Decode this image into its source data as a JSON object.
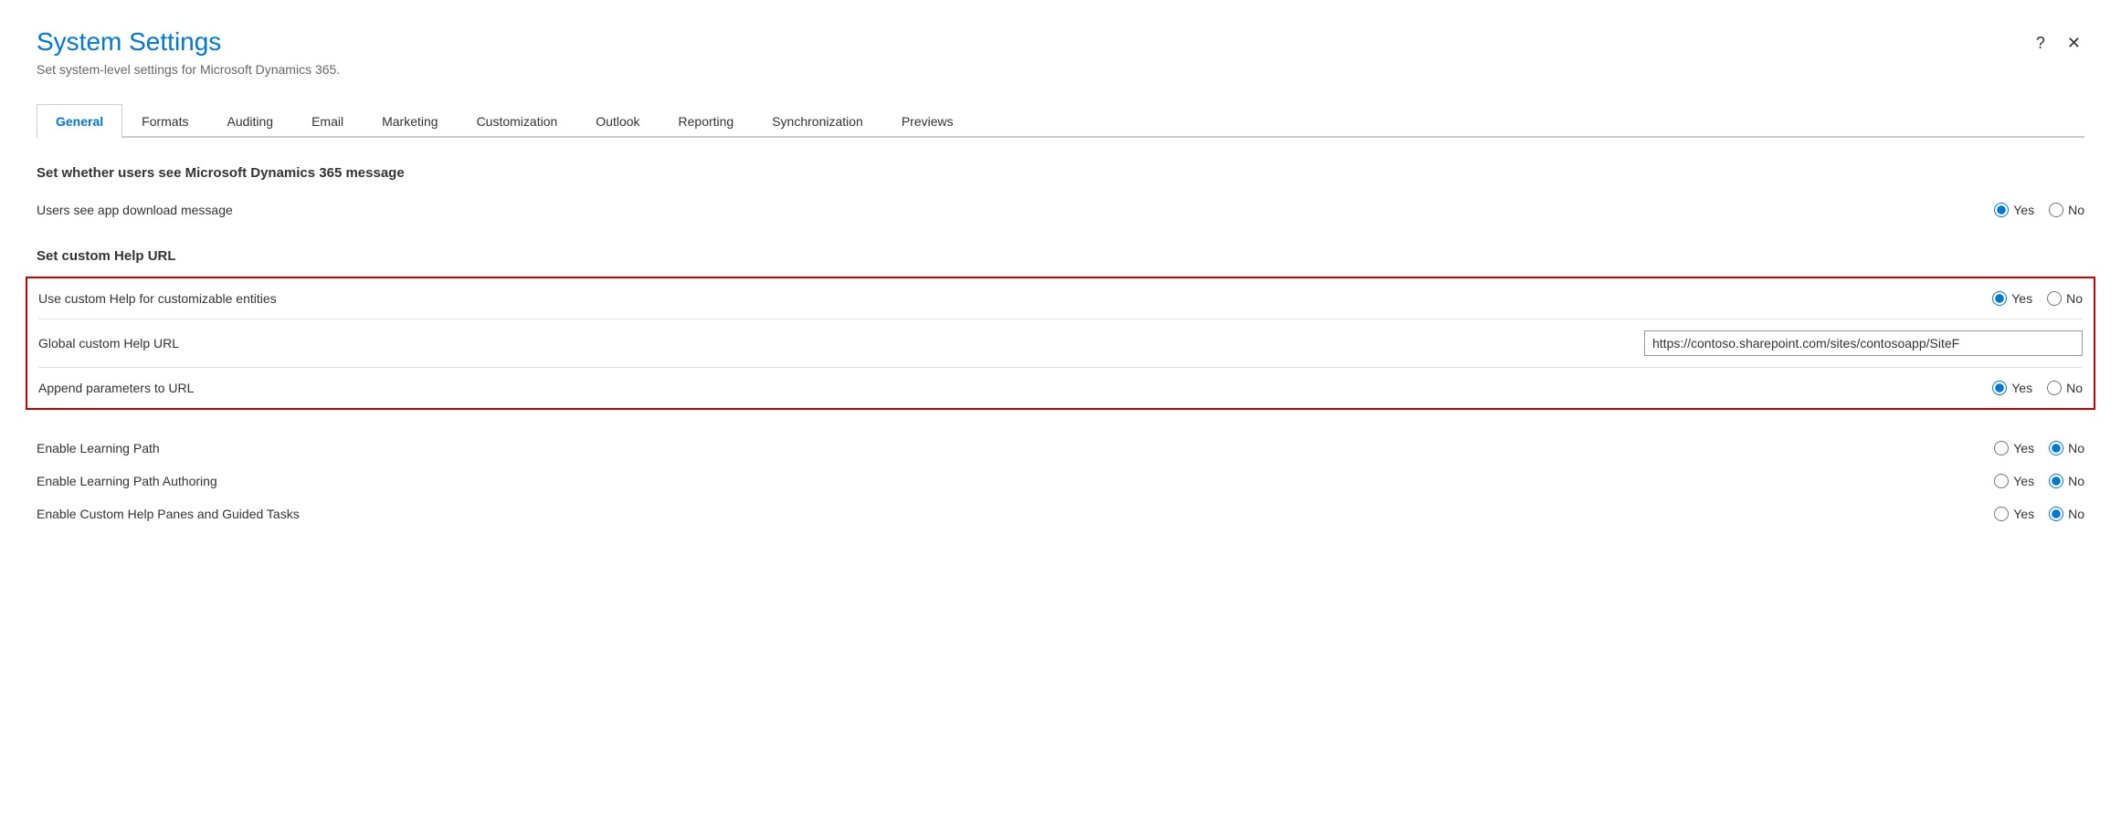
{
  "dialog": {
    "title": "System Settings",
    "subtitle": "Set system-level settings for Microsoft Dynamics 365.",
    "help_btn": "?",
    "close_btn": "✕"
  },
  "tabs": [
    {
      "id": "general",
      "label": "General",
      "active": true
    },
    {
      "id": "formats",
      "label": "Formats",
      "active": false
    },
    {
      "id": "auditing",
      "label": "Auditing",
      "active": false
    },
    {
      "id": "email",
      "label": "Email",
      "active": false
    },
    {
      "id": "marketing",
      "label": "Marketing",
      "active": false
    },
    {
      "id": "customization",
      "label": "Customization",
      "active": false
    },
    {
      "id": "outlook",
      "label": "Outlook",
      "active": false
    },
    {
      "id": "reporting",
      "label": "Reporting",
      "active": false
    },
    {
      "id": "synchronization",
      "label": "Synchronization",
      "active": false
    },
    {
      "id": "previews",
      "label": "Previews",
      "active": false
    }
  ],
  "sections": {
    "dynamics_message": {
      "heading": "Set whether users see Microsoft Dynamics 365 message",
      "rows": [
        {
          "id": "app_download_message",
          "label": "Users see app download message",
          "yes_checked": true,
          "no_checked": false
        }
      ]
    },
    "custom_help_url": {
      "heading": "Set custom Help URL",
      "highlighted_rows": [
        {
          "id": "use_custom_help",
          "label": "Use custom Help for customizable entities",
          "type": "radio",
          "yes_checked": true,
          "no_checked": false
        },
        {
          "id": "global_custom_help_url",
          "label": "Global custom Help URL",
          "type": "input",
          "value": "https://contoso.sharepoint.com/sites/contosoapp/SiteF"
        },
        {
          "id": "append_parameters",
          "label": "Append parameters to URL",
          "type": "radio",
          "yes_checked": true,
          "no_checked": false
        }
      ]
    },
    "learning": {
      "rows": [
        {
          "id": "enable_learning_path",
          "label": "Enable Learning Path",
          "yes_checked": false,
          "no_checked": true
        },
        {
          "id": "enable_learning_path_authoring",
          "label": "Enable Learning Path Authoring",
          "yes_checked": false,
          "no_checked": true
        },
        {
          "id": "enable_custom_help_panes",
          "label": "Enable Custom Help Panes and Guided Tasks",
          "yes_checked": false,
          "no_checked": true
        }
      ]
    }
  },
  "labels": {
    "yes": "Yes",
    "no": "No"
  }
}
